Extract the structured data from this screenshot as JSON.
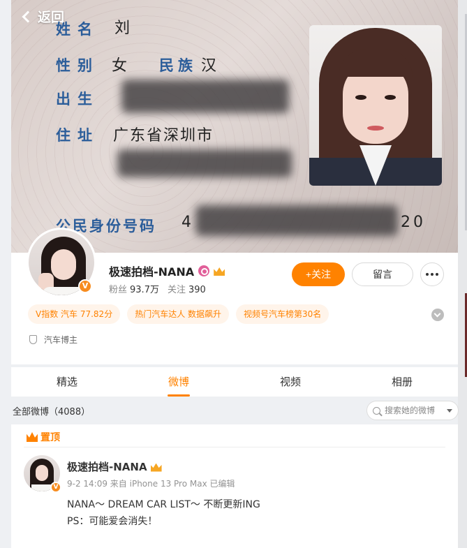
{
  "nav": {
    "back_label": "返回"
  },
  "id_card": {
    "name_label": "姓名",
    "name_value": "刘",
    "gender_label": "性别",
    "gender_value": "女",
    "ethnic_label": "民族",
    "ethnic_value": "汉",
    "birth_label": "出生",
    "address_label": "住址",
    "address_value": "广东省深圳市",
    "idno_label": "公民身份号码",
    "idno_start": "4",
    "idno_end": "20"
  },
  "profile": {
    "nickname": "极速拍档-NANA",
    "fans_label": "粉丝",
    "fans_value": "93.7万",
    "follow_label": "关注",
    "follow_value": "390",
    "follow_button": "+关注",
    "message_button": "留言",
    "verified_badge": "V",
    "tags": [
      "V指数 汽车 77.82分",
      "热门汽车达人 数据飙升",
      "视频号汽车榜第30名"
    ],
    "role": "汽车博主"
  },
  "tabs": [
    "精选",
    "微博",
    "视频",
    "相册"
  ],
  "active_tab": 1,
  "filter": {
    "all_label": "全部微博（4088）",
    "search_placeholder": "搜索她的微博"
  },
  "post": {
    "pinned_label": "置顶",
    "author": "极速拍档-NANA",
    "meta": "9-2 14:09  来自 iPhone 13 Pro Max 已编辑",
    "lines": [
      "NANA～ DREAM CAR LIST～ 不断更新ING",
      "PS：可能爱会消失！"
    ]
  },
  "colors": {
    "accent": "#ff8200",
    "tag_bg": "#fff4ea",
    "id_label_blue": "#2b5d9a"
  },
  "icons": [
    "back-chevron-icon",
    "pink-badge-icon",
    "crown-icon",
    "more-icon",
    "shield-icon",
    "search-icon",
    "dropdown-caret-icon",
    "expand-chevron-icon"
  ]
}
